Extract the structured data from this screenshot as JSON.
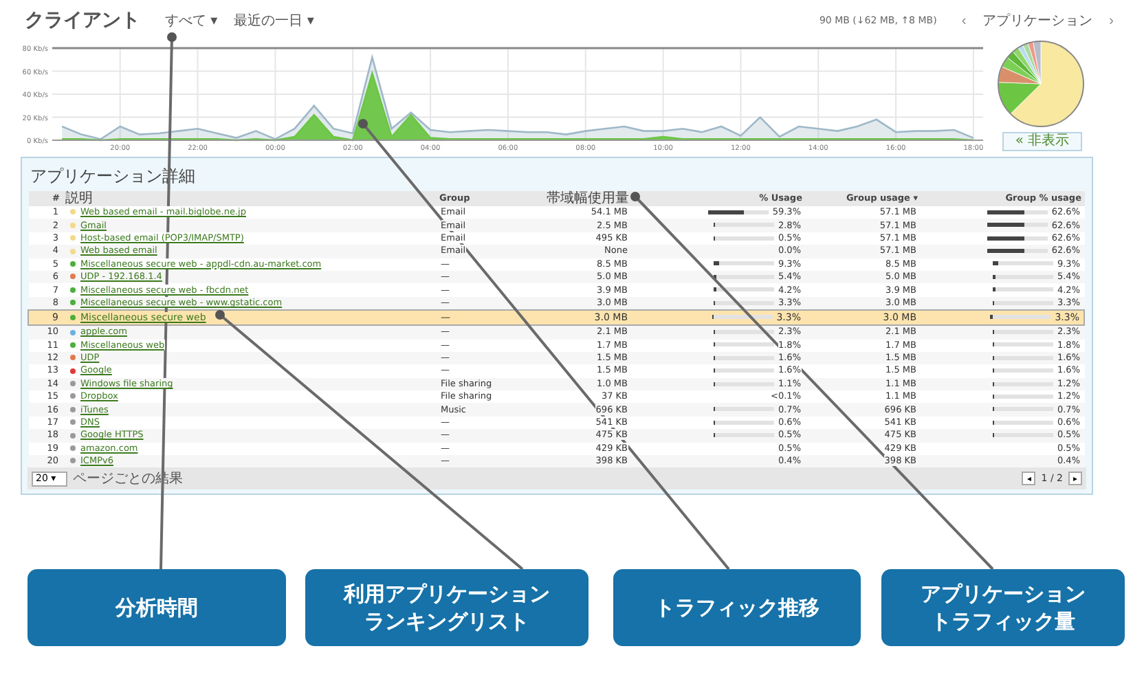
{
  "header": {
    "title": "クライアント",
    "filters": [
      {
        "label": "すべて",
        "caret": "▾"
      },
      {
        "label": "最近の一日",
        "caret": "▾"
      }
    ],
    "summary": "90 MB (↓62 MB, ↑8 MB)",
    "pie_nav": {
      "prev": "‹",
      "label": "アプリケーション",
      "next": "›"
    }
  },
  "traffic_chart": {
    "chart_data": {
      "type": "area",
      "categories": [
        null,
        null,
        null,
        "20:00",
        null,
        null,
        null,
        "22:00",
        null,
        null,
        null,
        "00:00",
        null,
        null,
        null,
        "02:00",
        null,
        null,
        null,
        "04:00",
        null,
        null,
        null,
        "06:00",
        null,
        null,
        null,
        "08:00",
        null,
        null,
        null,
        "10:00",
        null,
        null,
        null,
        "12:00",
        null,
        null,
        null,
        "14:00",
        null,
        null,
        null,
        "16:00",
        null,
        null,
        null,
        "18:00"
      ],
      "series": [
        {
          "color": "#9fb8c8",
          "values": [
            12,
            5,
            1,
            12,
            5,
            6,
            8,
            10,
            6,
            2,
            8,
            1,
            10,
            30,
            10,
            6,
            72,
            10,
            24,
            9,
            7,
            8,
            9,
            8,
            7,
            7,
            5,
            8,
            10,
            12,
            8,
            8,
            10,
            7,
            12,
            4,
            20,
            3,
            12,
            10,
            8,
            12,
            18,
            7,
            8,
            8,
            9,
            2
          ]
        },
        {
          "color": "#6cc644",
          "values": [
            1,
            1,
            0,
            1,
            1,
            1,
            1,
            1,
            1,
            0,
            1,
            0,
            3,
            22,
            3,
            0,
            58,
            3,
            22,
            2,
            1,
            1,
            1,
            1,
            1,
            1,
            1,
            1,
            1,
            1,
            1,
            3,
            1,
            1,
            1,
            1,
            1,
            1,
            1,
            1,
            1,
            1,
            1,
            1,
            1,
            1,
            1,
            0
          ]
        }
      ],
      "ylim": [
        0,
        80
      ],
      "grid": true,
      "yticks": [
        {
          "value": 0,
          "label": "0 Kb/s"
        },
        {
          "value": 20,
          "label": "20 Kb/s"
        },
        {
          "value": 40,
          "label": "40 Kb/s"
        },
        {
          "value": 60,
          "label": "60 Kb/s"
        },
        {
          "value": 80,
          "label": "80 Kb/s"
        }
      ]
    }
  },
  "toggle_button": "« 非表示",
  "details": {
    "title": "アプリケーション詳細",
    "columns": [
      "#",
      "説明",
      "Group",
      "帯域幅使用量",
      "% Usage",
      "Group usage ▾",
      "Group % usage"
    ],
    "rows": [
      {
        "num": "1",
        "name": "Web based email - mail.biglobe.ne.jp",
        "color": "#f3d98a",
        "group": "Email",
        "usage": "54.1 MB",
        "pct": "59.3%",
        "usage_bar": {
          "level": 0.593
        },
        "group_usage": "57.1 MB",
        "group_pct": "62.6%",
        "group_bar": {
          "level": 0.626
        },
        "selected": false
      },
      {
        "num": "2",
        "name": "Gmail",
        "color": "#f3d98a",
        "group": "Email",
        "usage": "2.5 MB",
        "pct": "2.8%",
        "usage_bar": {
          "level": 0.028
        },
        "group_usage": "57.1 MB",
        "group_pct": "62.6%",
        "group_bar": {
          "level": 0.626
        },
        "selected": false
      },
      {
        "num": "3",
        "name": "Host-based email (POP3/IMAP/SMTP)",
        "color": "#f3d98a",
        "group": "Email",
        "usage": "495 KB",
        "pct": "0.5%",
        "usage_bar": {
          "level": 0.005
        },
        "group_usage": "57.1 MB",
        "group_pct": "62.6%",
        "group_bar": {
          "level": 0.626
        },
        "selected": false
      },
      {
        "num": "4",
        "name": "Web based email",
        "color": "#f3d98a",
        "group": "Email",
        "usage": "None",
        "pct": "0.0%",
        "group_usage": "57.1 MB",
        "group_pct": "62.6%",
        "group_bar": {
          "level": 0.626
        },
        "selected": false
      },
      {
        "num": "5",
        "name": "Miscellaneous secure web - appdl-cdn.au-market.com",
        "color": "#4caf3a",
        "group": "—",
        "usage": "8.5 MB",
        "pct": "9.3%",
        "usage_bar": {
          "level": 0.093
        },
        "group_usage": "8.5 MB",
        "group_pct": "9.3%",
        "group_bar": {
          "level": 0.093
        },
        "selected": false
      },
      {
        "num": "6",
        "name": "UDP - 192.168.1.4",
        "color": "#e07b4f",
        "group": "—",
        "usage": "5.0 MB",
        "pct": "5.4%",
        "usage_bar": {
          "level": 0.054
        },
        "group_usage": "5.0 MB",
        "group_pct": "5.4%",
        "group_bar": {
          "level": 0.054
        },
        "selected": false
      },
      {
        "num": "7",
        "name": "Miscellaneous secure web - fbcdn.net",
        "color": "#4caf3a",
        "group": "—",
        "usage": "3.9 MB",
        "pct": "4.2%",
        "usage_bar": {
          "level": 0.042
        },
        "group_usage": "3.9 MB",
        "group_pct": "4.2%",
        "group_bar": {
          "level": 0.042
        },
        "selected": false
      },
      {
        "num": "8",
        "name": "Miscellaneous secure web - www.gstatic.com",
        "color": "#4caf3a",
        "group": "—",
        "usage": "3.0 MB",
        "pct": "3.3%",
        "usage_bar": {
          "level": 0.033
        },
        "group_usage": "3.0 MB",
        "group_pct": "3.3%",
        "group_bar": {
          "level": 0.033
        },
        "selected": false
      },
      {
        "num": "9",
        "name": "Miscellaneous secure web",
        "color": "#4caf3a",
        "group": "—",
        "usage": "3.0 MB",
        "pct": "3.3%",
        "usage_bar": {
          "level": 0.033
        },
        "group_usage": "3.0 MB",
        "group_pct": "3.3%",
        "group_bar": {
          "level": 0.033
        },
        "selected": true
      },
      {
        "num": "10",
        "name": "apple.com",
        "color": "#6ab0e0",
        "group": "—",
        "usage": "2.1 MB",
        "pct": "2.3%",
        "usage_bar": {
          "level": 0.023
        },
        "group_usage": "2.1 MB",
        "group_pct": "2.3%",
        "group_bar": {
          "level": 0.023
        },
        "selected": false
      },
      {
        "num": "11",
        "name": "Miscellaneous web",
        "color": "#4caf3a",
        "group": "—",
        "usage": "1.7 MB",
        "pct": "1.8%",
        "usage_bar": {
          "level": 0.018
        },
        "group_usage": "1.7 MB",
        "group_pct": "1.8%",
        "group_bar": {
          "level": 0.018
        },
        "selected": false
      },
      {
        "num": "12",
        "name": "UDP",
        "color": "#e07b4f",
        "group": "—",
        "usage": "1.5 MB",
        "pct": "1.6%",
        "usage_bar": {
          "level": 0.016
        },
        "group_usage": "1.5 MB",
        "group_pct": "1.6%",
        "group_bar": {
          "level": 0.016
        },
        "selected": false
      },
      {
        "num": "13",
        "name": "Google",
        "color": "#e03a3a",
        "group": "—",
        "usage": "1.5 MB",
        "pct": "1.6%",
        "usage_bar": {
          "level": 0.016
        },
        "group_usage": "1.5 MB",
        "group_pct": "1.6%",
        "group_bar": {
          "level": 0.016
        },
        "selected": false
      },
      {
        "num": "14",
        "name": "Windows file sharing",
        "color": "#9a9a9a",
        "group": "File sharing",
        "usage": "1.0 MB",
        "pct": "1.1%",
        "usage_bar": {
          "level": 0.011
        },
        "group_usage": "1.1 MB",
        "group_pct": "1.2%",
        "group_bar": {
          "level": 0.012
        },
        "selected": false
      },
      {
        "num": "15",
        "name": "Dropbox",
        "color": "#9a9a9a",
        "group": "File sharing",
        "usage": "37 KB",
        "pct": "<0.1%",
        "group_usage": "1.1 MB",
        "group_pct": "1.2%",
        "group_bar": {
          "level": 0.012
        },
        "selected": false
      },
      {
        "num": "16",
        "name": "iTunes",
        "color": "#9a9a9a",
        "group": "Music",
        "usage": "696 KB",
        "pct": "0.7%",
        "usage_bar": {
          "level": 0.007
        },
        "group_usage": "696 KB",
        "group_pct": "0.7%",
        "group_bar": {
          "level": 0.007
        },
        "selected": false
      },
      {
        "num": "17",
        "name": "DNS",
        "color": "#9a9a9a",
        "group": "—",
        "usage": "541 KB",
        "pct": "0.6%",
        "usage_bar": {
          "level": 0.006
        },
        "group_usage": "541 KB",
        "group_pct": "0.6%",
        "group_bar": {
          "level": 0.006
        },
        "selected": false
      },
      {
        "num": "18",
        "name": "Google HTTPS",
        "color": "#9a9a9a",
        "group": "—",
        "usage": "475 KB",
        "pct": "0.5%",
        "usage_bar": {
          "level": 0.005
        },
        "group_usage": "475 KB",
        "group_pct": "0.5%",
        "group_bar": {
          "level": 0.005
        },
        "selected": false
      },
      {
        "num": "19",
        "name": "amazon.com",
        "color": "#9a9a9a",
        "group": "—",
        "usage": "429 KB",
        "pct": "0.5%",
        "group_usage": "429 KB",
        "group_pct": "0.5%",
        "selected": false
      },
      {
        "num": "20",
        "name": "ICMPv6",
        "color": "#9a9a9a",
        "group": "—",
        "usage": "398 KB",
        "pct": "0.4%",
        "group_usage": "398 KB",
        "group_pct": "0.4%",
        "selected": false
      }
    ],
    "page_size": {
      "value": "20",
      "caret": "▾",
      "label": "ページごとの結果"
    },
    "pager": {
      "prev": "◂",
      "current": "1",
      "separator": "/",
      "total": "2",
      "next": "▸"
    }
  },
  "callouts": [
    {
      "lines": [
        "分析時間"
      ]
    },
    {
      "lines": [
        "利用アプリケーション",
        "ランキングリスト"
      ]
    },
    {
      "lines": [
        "トラフィック推移"
      ]
    },
    {
      "lines": [
        "アプリケーション",
        "トラフィック量"
      ]
    }
  ]
}
